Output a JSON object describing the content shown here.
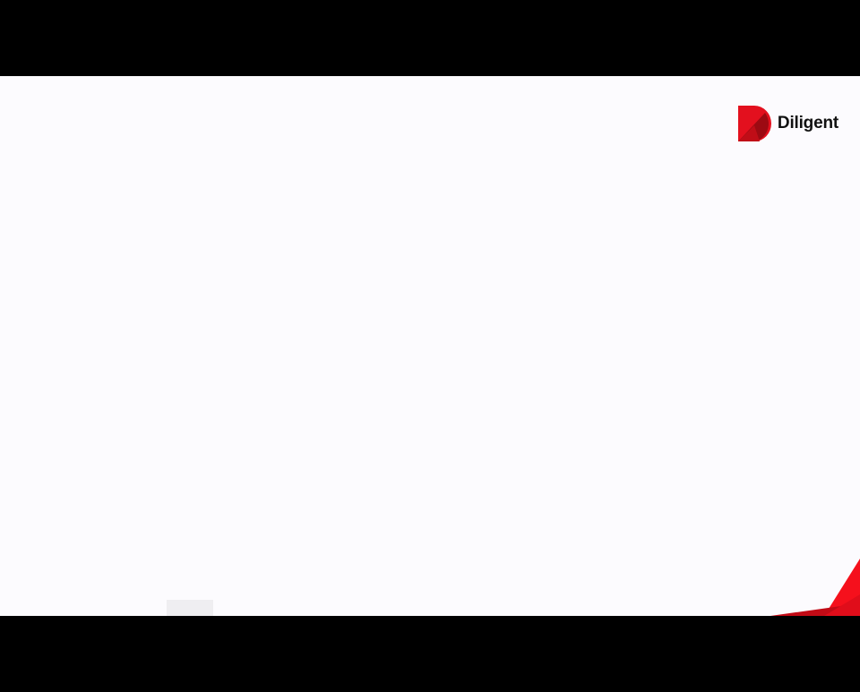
{
  "brand": {
    "name": "Diligent",
    "logo_icon": "diligent-d-logo",
    "color_primary": "#e3101e",
    "color_dark": "#9c0a12"
  },
  "slide": {
    "background": "#fcfbfe"
  },
  "decorations": {
    "corner_icon": "red-triangle-accent",
    "corner_color": "#f5101c"
  }
}
